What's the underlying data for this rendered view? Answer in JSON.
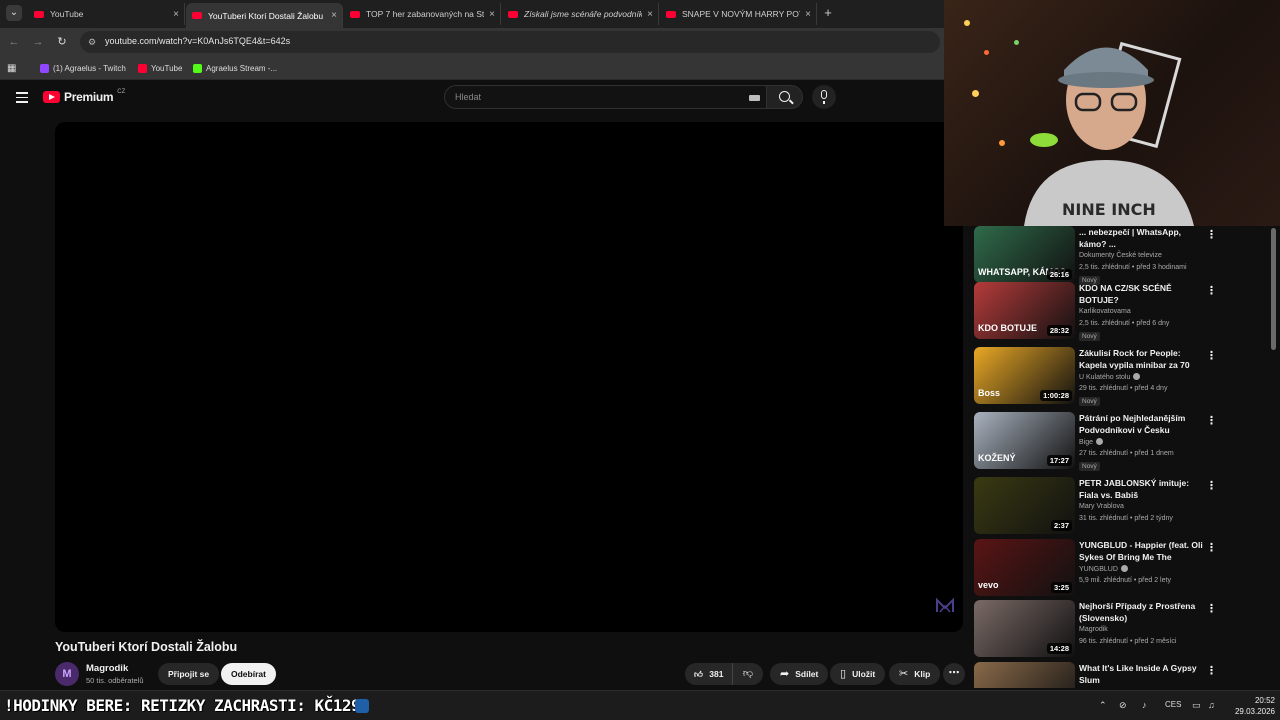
{
  "browser": {
    "tabs": [
      {
        "label": "YouTube",
        "active": false
      },
      {
        "label": "YouTuberi Ktorí Dostali Žalobu",
        "active": true
      },
      {
        "label": "TOP 7 her zabanovaných na Ste",
        "active": false
      },
      {
        "label": "Získali jsme scénáře podvodník",
        "active": false
      },
      {
        "label": "SNAPE V NOVÝM HARRY POTT",
        "active": false
      }
    ],
    "tab_close": "×",
    "new_tab": "+",
    "url": "youtube.com/watch?v=K0AnJs6TQE4&t=642s",
    "bookmarks": [
      {
        "label": "(1) Agraelus - Twitch",
        "color": "#9146ff"
      },
      {
        "label": "YouTube",
        "color": "#ff0033"
      },
      {
        "label": "Agraelus Stream -...",
        "color": "#53fc18"
      }
    ]
  },
  "youtube": {
    "logo_text": "Premium",
    "logo_region": "CZ",
    "search_placeholder": "Hledat",
    "video_title": "YouTuberi Ktorí Dostali Žalobu",
    "channel": {
      "name": "Magrodik",
      "subscribers": "50 tis. odběratelů",
      "avatar_letter": "M"
    },
    "actions": {
      "join": "Připojit se",
      "subscribe": "Odebírat",
      "likes": "381",
      "share": "Sdílet",
      "save": "Uložit",
      "clip": "Klip"
    },
    "recommendations": [
      {
        "title": "... nebezpečí | WhatsApp, kámo? ...",
        "channel": "Dokumenty České televize",
        "meta": "2,5 tis. zhlédnutí • před 3 hodinami",
        "duration": "26:16",
        "badge": "Nový",
        "thumb_text": "WHATSAPP, KÁMO?",
        "thumb_color": "#2f6b4a",
        "verified": false
      },
      {
        "title": "KDO NA CZ/SK SCÉNĚ BOTUJE?",
        "channel": "Karlikovatovama",
        "meta": "2,5 tis. zhlédnutí • před 6 dny",
        "duration": "28:32",
        "badge": "Nový",
        "thumb_text": "KDO BOTUJE",
        "thumb_color": "#b63b3b",
        "verified": false
      },
      {
        "title": "Zákulisí Rock for People: Kapela vypila minibar za 70 tisíc a ...",
        "channel": "U Kulatého stolu",
        "meta": "29 tis. zhlédnutí • před 4 dny",
        "duration": "1:00:28",
        "badge": "Nový",
        "thumb_text": "Boss",
        "thumb_color": "#e9a825",
        "verified": true
      },
      {
        "title": "Pátrání po Nejhledanějším Podvodníkovi v Česku",
        "channel": "Bige",
        "meta": "27 tis. zhlédnutí • před 1 dnem",
        "duration": "17:27",
        "badge": "Nový",
        "thumb_text": "KOŽENÝ",
        "thumb_color": "#a9b2bf",
        "verified": true
      },
      {
        "title": "PETR JABLONSKÝ imituje: Fiala vs. Babiš",
        "channel": "Mary Vrablova",
        "meta": "31 tis. zhlédnutí • před 2 týdny",
        "duration": "2:37",
        "badge": "",
        "thumb_text": "",
        "thumb_color": "#3a3a12",
        "verified": false
      },
      {
        "title": "YUNGBLUD - Happier (feat. Oli Sykes Of Bring Me The Horizo...",
        "channel": "YUNGBLUD",
        "meta": "5,9 mil. zhlédnutí • před 2 lety",
        "duration": "3:25",
        "badge": "",
        "thumb_text": "vevo",
        "thumb_color": "#5a1414",
        "verified": true
      },
      {
        "title": "Nejhorší Případy z Prostřena (Slovensko)",
        "channel": "Magrodik",
        "meta": "96 tis. zhlédnutí • před 2 měsíci",
        "duration": "14:28",
        "badge": "",
        "thumb_text": "",
        "thumb_color": "#7a6a66",
        "verified": false
      },
      {
        "title": "What It's Like Inside A Gypsy Slum",
        "channel": "",
        "meta": "",
        "duration": "",
        "badge": "",
        "thumb_text": "",
        "thumb_color": "#8a6a4a",
        "verified": false
      }
    ]
  },
  "taskbar": {
    "ticker": "!HODINKY BERE: RETIZKY ZACHRASTI: KČ129",
    "language": "CES",
    "time": "20:52",
    "date": "29.03.2026"
  },
  "colors": {
    "accent": "#ff0033",
    "background": "#0f0f0f",
    "pill": "#272727"
  }
}
